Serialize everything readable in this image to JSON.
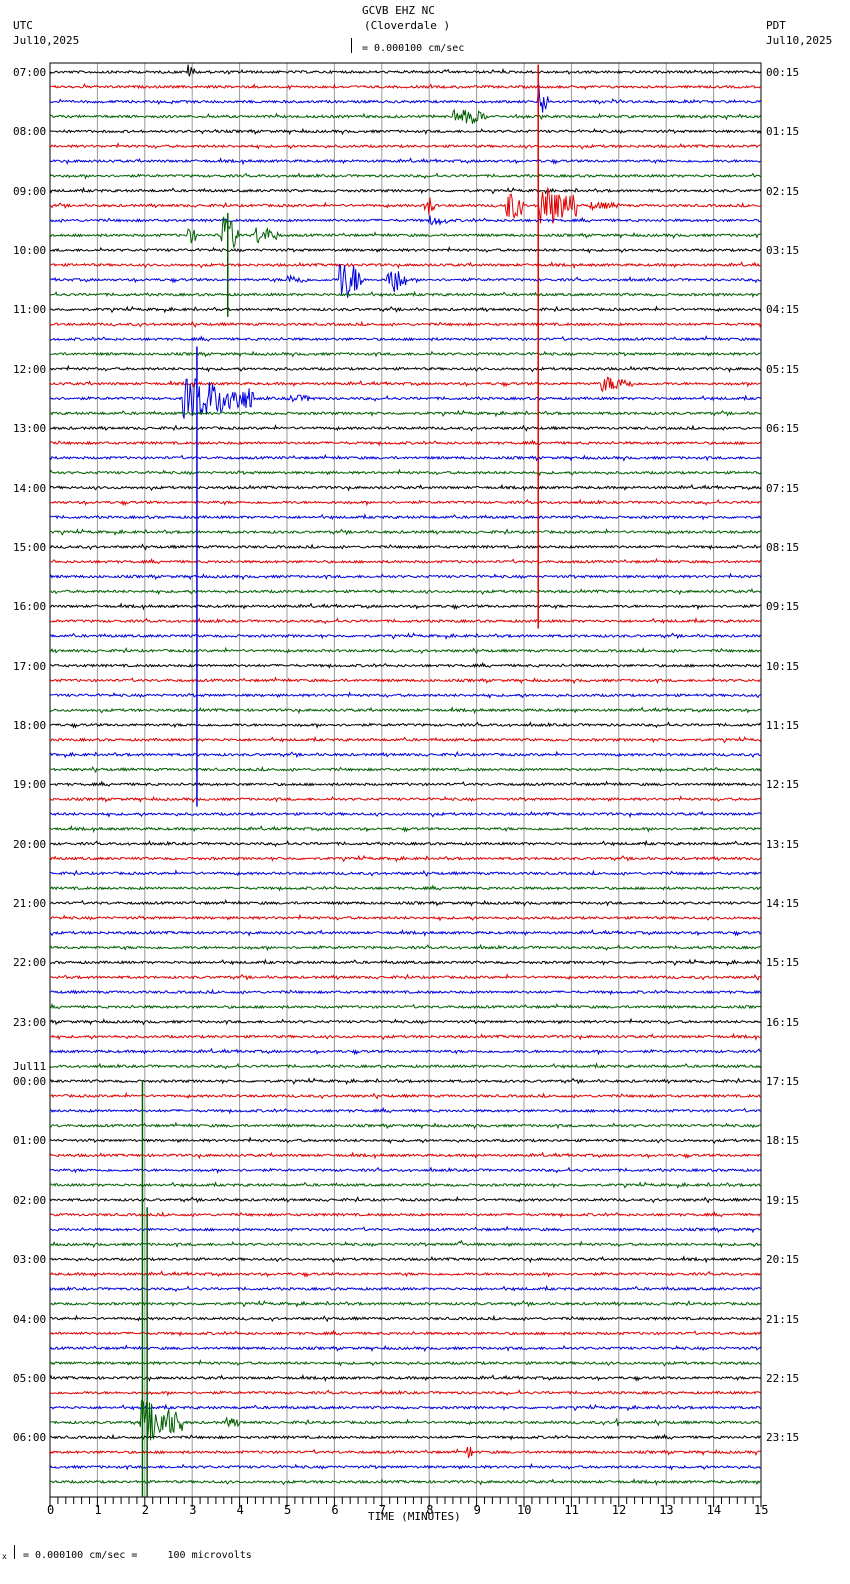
{
  "header": {
    "title": "GCVB EHZ NC",
    "subtitle": "(Cloverdale )",
    "scale": "= 0.000100 cm/sec",
    "left_tz": "UTC",
    "left_date": "Jul10,2025",
    "right_tz": "PDT",
    "right_date": "Jul10,2025"
  },
  "footer": {
    "scale_note": "= 0.000100 cm/sec =     100 microvolts",
    "mark": "x"
  },
  "chart_data": {
    "type": "line",
    "title": "GCVB EHZ NC (Cloverdale )",
    "xlabel": "TIME (MINUTES)",
    "xlim": [
      0,
      15
    ],
    "x_ticks": [
      "0",
      "1",
      "2",
      "3",
      "4",
      "5",
      "6",
      "7",
      "8",
      "9",
      "10",
      "11",
      "12",
      "13",
      "14",
      "15"
    ],
    "trace_count": 96,
    "trace_minutes": 15,
    "trace_colors": [
      "#000000",
      "#e00000",
      "#0000e0",
      "#006000"
    ],
    "left_labels": [
      "07:00",
      "08:00",
      "09:00",
      "10:00",
      "11:00",
      "12:00",
      "13:00",
      "14:00",
      "15:00",
      "16:00",
      "17:00",
      "18:00",
      "19:00",
      "20:00",
      "21:00",
      "22:00",
      "23:00",
      "00:00",
      "01:00",
      "02:00",
      "03:00",
      "04:00",
      "05:00",
      "06:00"
    ],
    "left_date_change": {
      "label": "Jul11",
      "before_hour_index": 17
    },
    "right_labels": [
      "00:15",
      "01:15",
      "02:15",
      "03:15",
      "04:15",
      "05:15",
      "06:15",
      "07:15",
      "08:15",
      "09:15",
      "10:15",
      "11:15",
      "12:15",
      "13:15",
      "14:15",
      "15:15",
      "16:15",
      "17:15",
      "18:15",
      "19:15",
      "20:15",
      "21:15",
      "22:15",
      "23:15"
    ],
    "events_note": "trace index, start minute, duration minutes, amplitude in trace-spacing units",
    "events": [
      {
        "trace": 0,
        "minute": 2.9,
        "dur": 0.15,
        "amp": 0.5
      },
      {
        "trace": 3,
        "minute": 8.5,
        "dur": 0.7,
        "amp": 0.5
      },
      {
        "trace": 2,
        "minute": 10.3,
        "dur": 0.2,
        "amp": 1.2
      },
      {
        "trace": 9,
        "minute": 7.9,
        "dur": 0.2,
        "amp": 0.9
      },
      {
        "trace": 9,
        "minute": 9.6,
        "dur": 0.4,
        "amp": 1.1
      },
      {
        "trace": 9,
        "minute": 10.3,
        "dur": 0.8,
        "amp": 1.5
      },
      {
        "trace": 9,
        "minute": 11.4,
        "dur": 0.6,
        "amp": 0.2
      },
      {
        "trace": 10,
        "minute": 8.0,
        "dur": 0.4,
        "amp": 0.3
      },
      {
        "trace": 11,
        "minute": 2.9,
        "dur": 0.2,
        "amp": 0.6
      },
      {
        "trace": 11,
        "minute": 3.6,
        "dur": 0.4,
        "amp": 1.4
      },
      {
        "trace": 11,
        "minute": 4.3,
        "dur": 0.5,
        "amp": 0.6
      },
      {
        "trace": 14,
        "minute": 6.1,
        "dur": 0.5,
        "amp": 1.5
      },
      {
        "trace": 14,
        "minute": 7.1,
        "dur": 0.4,
        "amp": 1.1
      },
      {
        "trace": 14,
        "minute": 5.0,
        "dur": 0.4,
        "amp": 0.3
      },
      {
        "trace": 21,
        "minute": 11.6,
        "dur": 0.7,
        "amp": 0.5
      },
      {
        "trace": 22,
        "minute": 2.8,
        "dur": 1.5,
        "amp": 1.4
      },
      {
        "trace": 22,
        "minute": 5.0,
        "dur": 0.6,
        "amp": 0.2
      },
      {
        "trace": 79,
        "minute": 8.6,
        "dur": 0.1,
        "amp": 0.4
      },
      {
        "trace": 91,
        "minute": 1.9,
        "dur": 0.9,
        "amp": 1.5
      },
      {
        "trace": 91,
        "minute": 3.7,
        "dur": 0.3,
        "amp": 0.3
      },
      {
        "trace": 91,
        "minute": 11.9,
        "dur": 0.1,
        "amp": 0.3
      },
      {
        "trace": 93,
        "minute": 8.8,
        "dur": 0.1,
        "amp": 0.7
      }
    ],
    "clipped": [
      {
        "trace": 9,
        "minute": 10.3,
        "up": 9.5,
        "down": 28.5
      },
      {
        "trace": 22,
        "minute": 3.1,
        "up": 3.5,
        "down": 27.5
      },
      {
        "trace": 11,
        "minute": 3.75,
        "up": 1.5,
        "down": 5.5
      },
      {
        "trace": 91,
        "minute": 1.95,
        "up": 23.0,
        "down": 5.0
      },
      {
        "trace": 91,
        "minute": 2.05,
        "up": 14.5,
        "down": 5.0
      }
    ]
  }
}
